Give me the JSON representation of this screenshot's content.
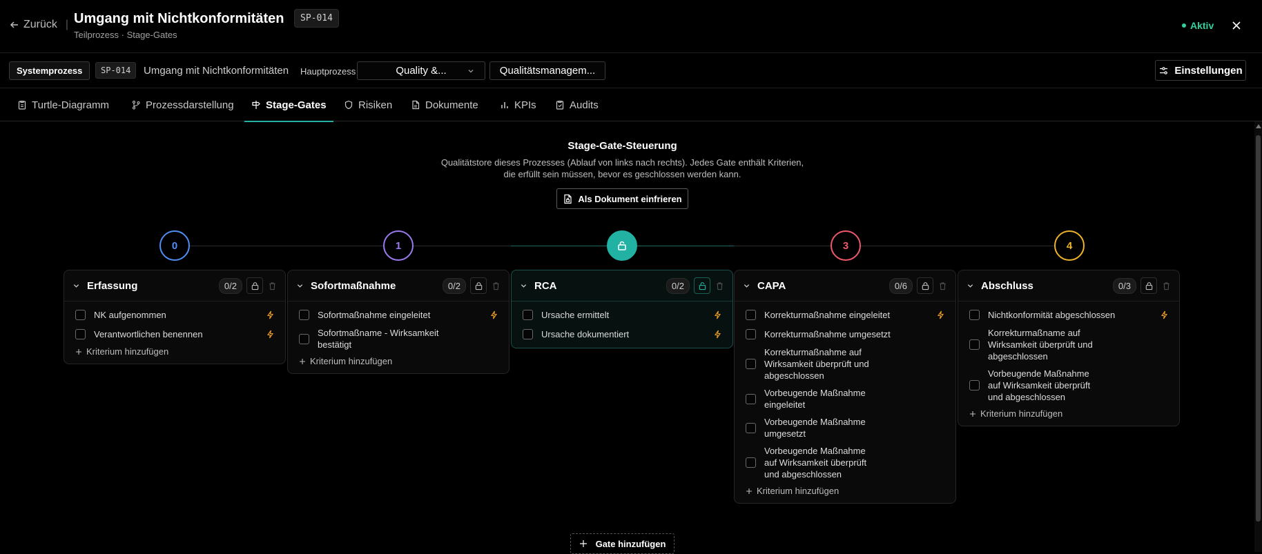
{
  "header": {
    "back_label": "Zurück",
    "title": "Umgang mit Nichtkonformitäten",
    "subtitle": "Teilprozess · Stage-Gates",
    "code": "SP-014",
    "status": "Aktiv",
    "status_color": "#2fd29f"
  },
  "subbar": {
    "system_label": "Systemprozess",
    "code": "SP-014",
    "name": "Umgang mit Nichtkonformitäten",
    "main_label": "Hauptprozess",
    "main_select": "Quality &...",
    "second_select": "Qualitätsmanagem...",
    "settings_label": "Einstellungen"
  },
  "tabs": [
    {
      "label": "Turtle-Diagramm",
      "icon": "clipboard-icon"
    },
    {
      "label": "Prozessdarstellung",
      "icon": "git-branch-icon"
    },
    {
      "label": "Stage-Gates",
      "icon": "signpost-icon",
      "active": true
    },
    {
      "label": "Risiken",
      "icon": "shield-icon"
    },
    {
      "label": "Dokumente",
      "icon": "document-icon"
    },
    {
      "label": "KPIs",
      "icon": "bar-chart-icon"
    },
    {
      "label": "Audits",
      "icon": "clipboard-check-icon"
    }
  ],
  "section": {
    "title": "Stage-Gate-Steuerung",
    "description": "Qualitätstore dieses Prozesses (Ablauf von links nach rechts). Jedes Gate enthält Kriterien, die erfüllt sein müssen, bevor es geschlossen werden kann.",
    "freeze_button": "Als Dokument einfrieren",
    "add_gate_button": "Gate hinzufügen",
    "add_criterion_label": "Kriterium hinzufügen"
  },
  "accent_color": "#22b2a3",
  "gates": [
    {
      "number": "0",
      "name": "Erfassung",
      "count": "0/2",
      "color": "#4f8ff7",
      "criteria": [
        {
          "text": "NK aufgenommen",
          "bolt": true
        },
        {
          "text": "Verantwortlichen benennen",
          "bolt": true
        }
      ]
    },
    {
      "number": "1",
      "name": "Sofortmaßnahme",
      "count": "0/2",
      "color": "#9b7bf0",
      "criteria": [
        {
          "text": "Sofortmaßnahme eingeleitet",
          "bolt": true
        },
        {
          "text": "Sofortmaßname - Wirksamkeit bestätigt",
          "bolt": false
        }
      ]
    },
    {
      "number": "",
      "name": "RCA",
      "count": "0/2",
      "color": "#22b2a3",
      "active": true,
      "criteria": [
        {
          "text": "Ursache ermittelt",
          "bolt": true
        },
        {
          "text": "Ursache dokumentiert",
          "bolt": true
        }
      ]
    },
    {
      "number": "3",
      "name": "CAPA",
      "count": "0/6",
      "color": "#f0596b",
      "criteria": [
        {
          "text": "Korrekturmaßnahme eingeleitet",
          "bolt": true
        },
        {
          "text": "Korrekturmaßnahme umgesetzt",
          "bolt": false
        },
        {
          "text": "Korrekturmaßnahme auf Wirksamkeit überprüft und abgeschlossen",
          "bolt": false
        },
        {
          "text": "Vorbeugende Maßnahme eingeleitet",
          "bolt": false
        },
        {
          "text": "Vorbeugende Maßnahme umgesetzt",
          "bolt": false
        },
        {
          "text": "Vorbeugende Maßnahme auf Wirksamkeit überprüft und abgeschlossen",
          "bolt": false
        }
      ]
    },
    {
      "number": "4",
      "name": "Abschluss",
      "count": "0/3",
      "color": "#f0b429",
      "criteria": [
        {
          "text": "Nichtkonformität abgeschlossen",
          "bolt": true
        },
        {
          "text": "Korrekturmaßname auf Wirksamkeit überprüft und abgeschlossen",
          "bolt": false
        },
        {
          "text": "Vorbeugende Maßnahme auf Wirksamkeit überprüft und abgeschlossen",
          "bolt": false
        }
      ]
    }
  ]
}
